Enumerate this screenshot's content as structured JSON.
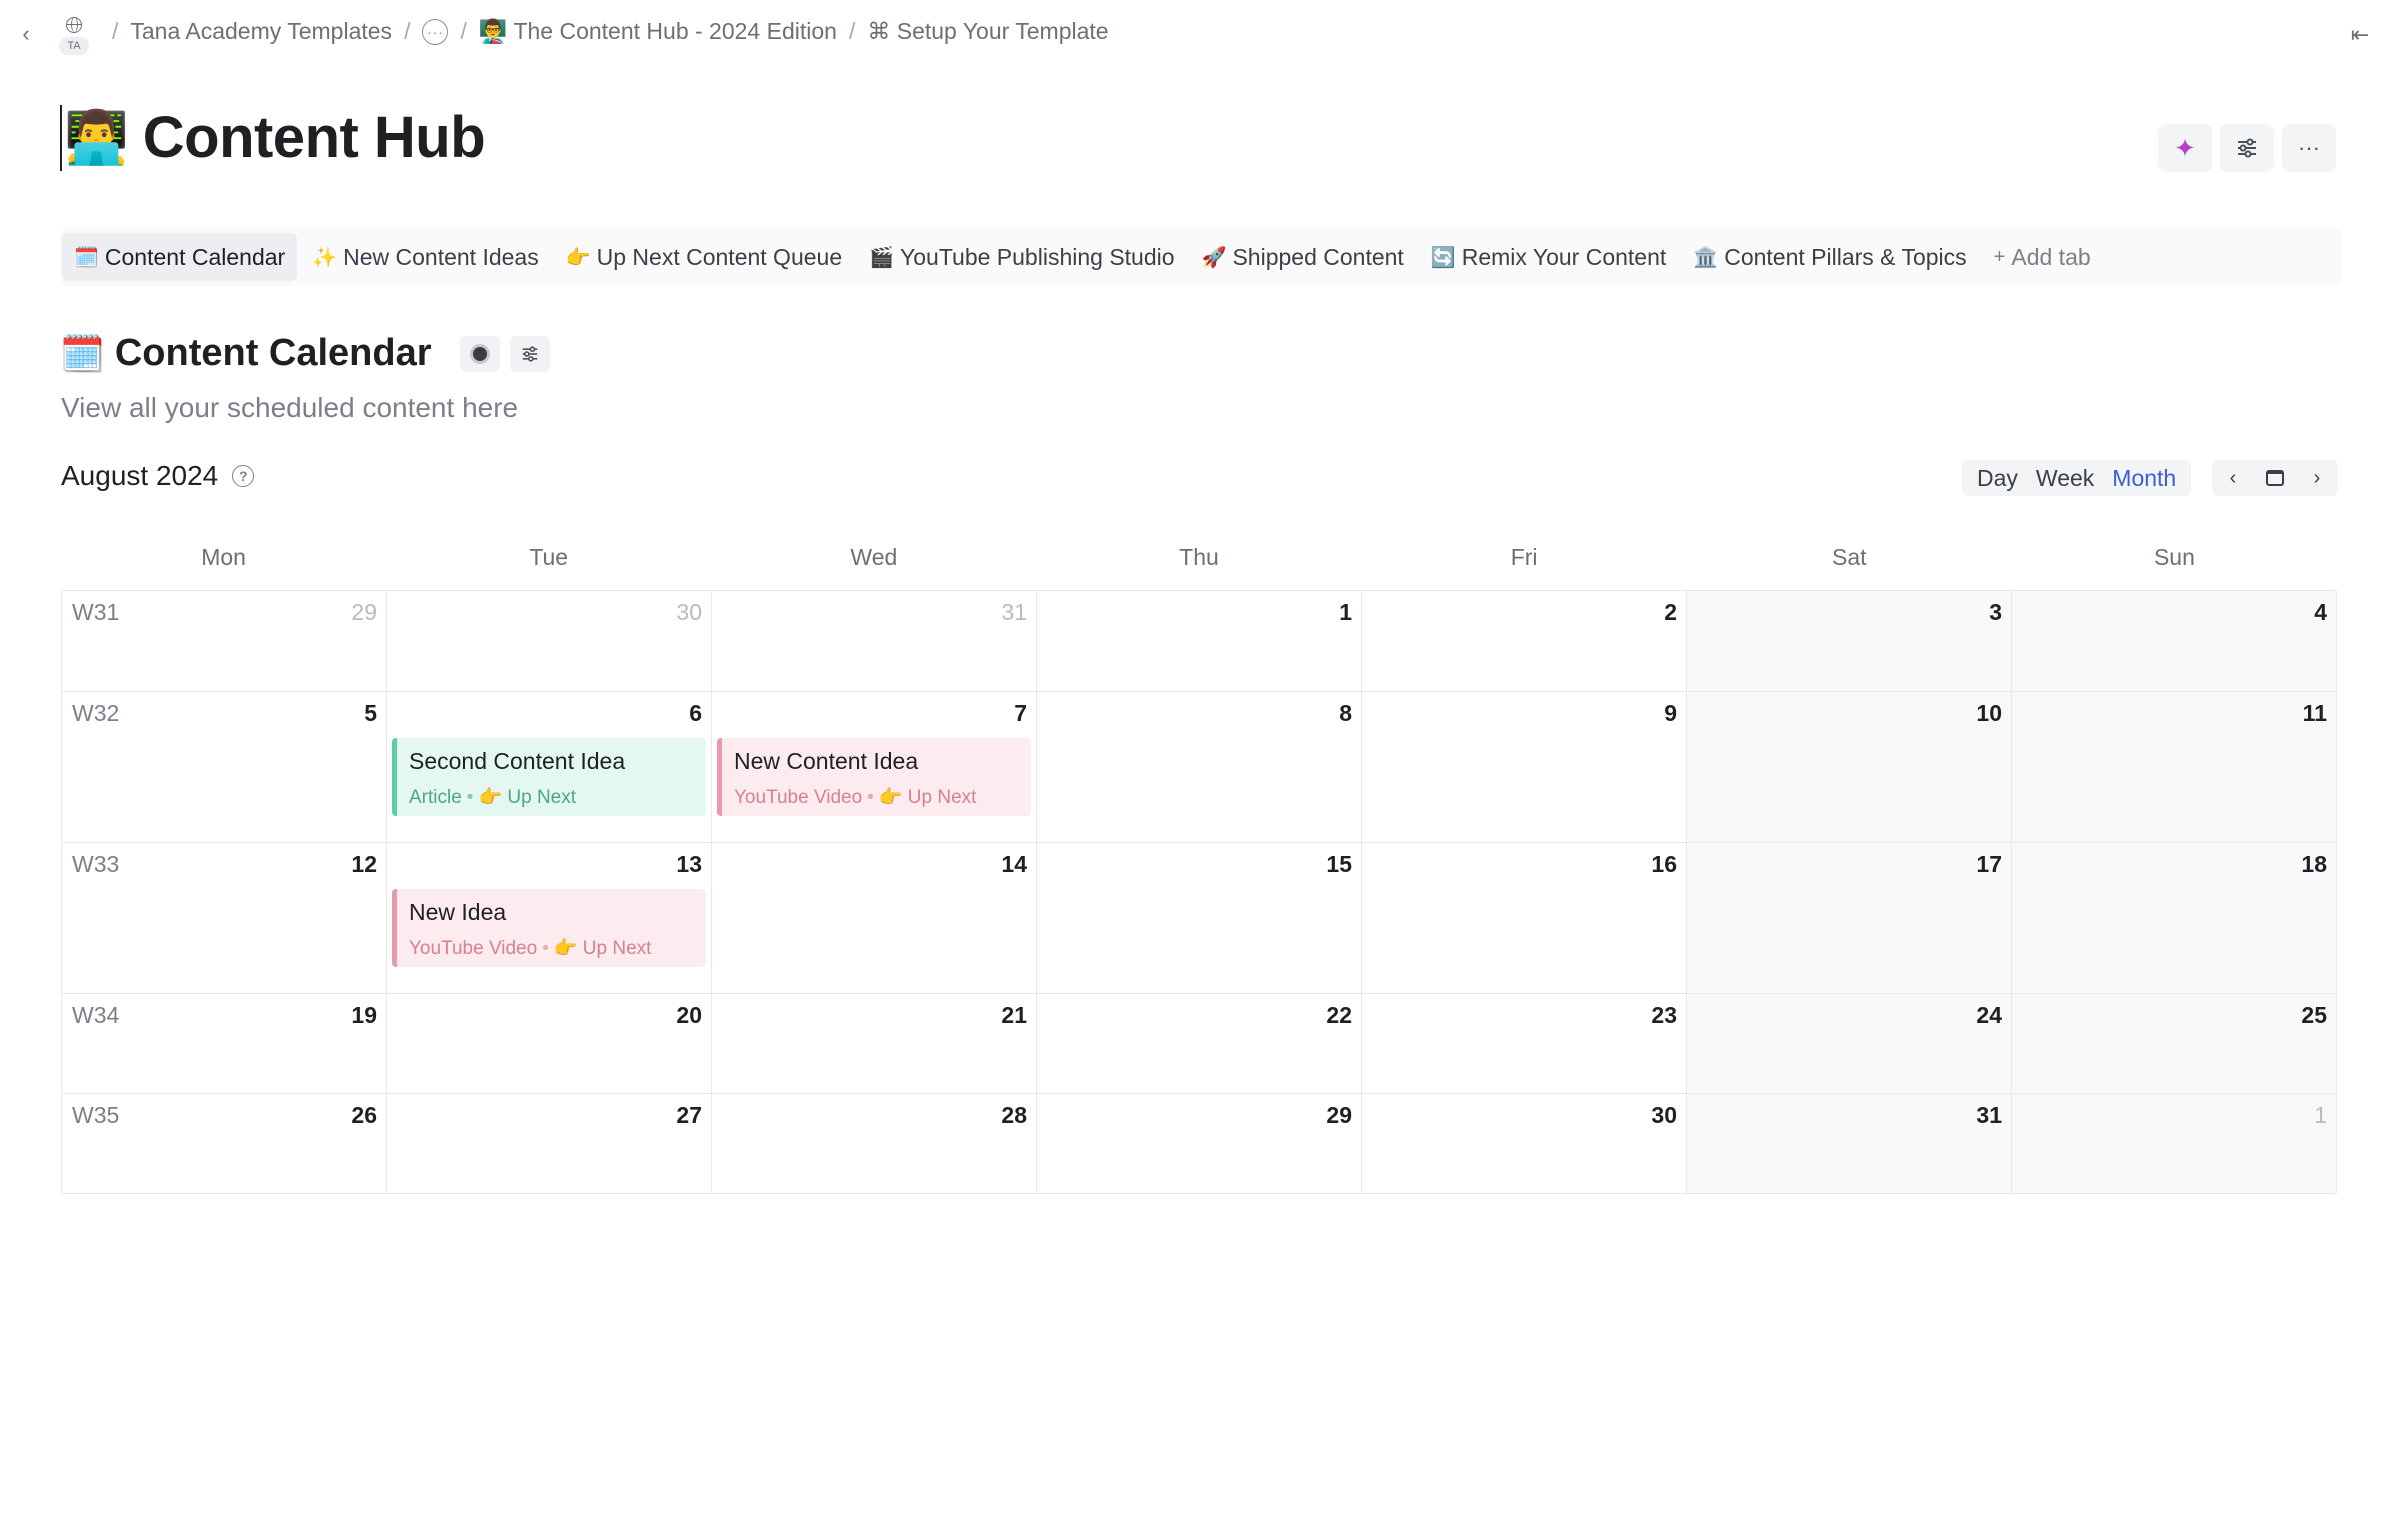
{
  "breadcrumb": {
    "workspace_badge": "TA",
    "items": [
      "Tana Academy Templates",
      "👨‍🏫 The Content Hub - 2024 Edition",
      "⌘ Setup Your Template"
    ]
  },
  "page": {
    "title_emoji": "👨‍💻",
    "title": "Content Hub"
  },
  "tabs": [
    {
      "emoji": "🗓️",
      "label": "Content Calendar",
      "active": true
    },
    {
      "emoji": "✨",
      "label": "New Content Ideas"
    },
    {
      "emoji": "👉",
      "label": "Up Next Content Queue"
    },
    {
      "emoji": "🎬",
      "label": "YouTube Publishing Studio"
    },
    {
      "emoji": "🚀",
      "label": "Shipped Content"
    },
    {
      "emoji": "🔄",
      "label": "Remix Your Content"
    },
    {
      "emoji": "🏛️",
      "label": "Content Pillars & Topics"
    }
  ],
  "add_tab_label": "Add tab",
  "section": {
    "emoji": "🗓️",
    "title": "Content Calendar",
    "subtitle": "View all your scheduled content here"
  },
  "calendar": {
    "month_label": "August 2024",
    "views": [
      "Day",
      "Week",
      "Month"
    ],
    "selected_view": "Month",
    "weekdays": [
      "Mon",
      "Tue",
      "Wed",
      "Thu",
      "Fri",
      "Sat",
      "Sun"
    ],
    "weeks": [
      {
        "label": "W31",
        "days": [
          "29",
          "30",
          "31",
          "1",
          "2",
          "3",
          "4"
        ],
        "outside": [
          0,
          1,
          2
        ]
      },
      {
        "label": "W32",
        "days": [
          "5",
          "6",
          "7",
          "8",
          "9",
          "10",
          "11"
        ],
        "outside": []
      },
      {
        "label": "W33",
        "days": [
          "12",
          "13",
          "14",
          "15",
          "16",
          "17",
          "18"
        ],
        "outside": []
      },
      {
        "label": "W34",
        "days": [
          "19",
          "20",
          "21",
          "22",
          "23",
          "24",
          "25"
        ],
        "outside": []
      },
      {
        "label": "W35",
        "days": [
          "26",
          "27",
          "28",
          "29",
          "30",
          "31",
          "1"
        ],
        "outside": [
          6
        ]
      }
    ],
    "events": [
      {
        "week": 1,
        "day": 1,
        "title": "Second Content Idea",
        "type": "Article",
        "status": "👉 Up Next",
        "color": "green"
      },
      {
        "week": 1,
        "day": 2,
        "title": "New Content Idea",
        "type": "YouTube Video",
        "status": "👉 Up Next",
        "color": "pink"
      },
      {
        "week": 2,
        "day": 1,
        "title": "New Idea",
        "type": "YouTube Video",
        "status": "👉 Up Next",
        "color": "pink"
      }
    ]
  },
  "colors": {
    "accent_view": "#3a5ed6",
    "event_green": "#5ccfa7",
    "event_pink": "#e89aa8",
    "ai_sparkle": "#b83fc9"
  },
  "icons": [
    "chevron-left-icon",
    "globe-icon",
    "more-circle-icon",
    "panel-collapse-icon",
    "sparkle-icon",
    "sliders-icon",
    "more-horizontal-icon",
    "record-dot-icon",
    "help-icon",
    "calendar-icon",
    "chevron-right-icon",
    "plus-icon"
  ]
}
